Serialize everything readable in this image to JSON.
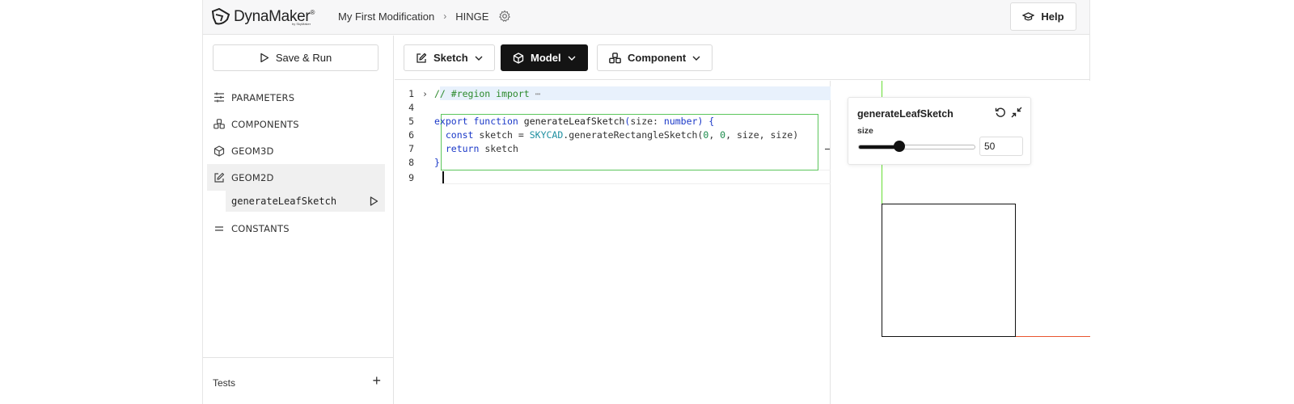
{
  "header": {
    "logo_text": "DynaMaker",
    "logo_sub": "by SkyMaker",
    "breadcrumb": [
      "My First Modification",
      "HINGE"
    ],
    "help_label": "Help"
  },
  "sidebar": {
    "save_run_label": "Save & Run",
    "items": [
      {
        "label": "PARAMETERS",
        "icon": "sliders-icon"
      },
      {
        "label": "COMPONENTS",
        "icon": "components-icon"
      },
      {
        "label": "GEOM3D",
        "icon": "cube-icon"
      },
      {
        "label": "GEOM2D",
        "icon": "edit-icon"
      },
      {
        "label": "CONSTANTS",
        "icon": "equals-icon"
      }
    ],
    "sub_item": "generateLeafSketch",
    "tests_label": "Tests"
  },
  "toolbar": {
    "sketch_label": "Sketch",
    "model_label": "Model",
    "component_label": "Component"
  },
  "editor": {
    "line_numbers": [
      "1",
      "4",
      "5",
      "6",
      "7",
      "8",
      "9"
    ]
  },
  "viewport": {
    "card_title": "generateLeafSketch",
    "param_label": "size",
    "param_value": "50",
    "slider_fraction": 0.35,
    "colors": {
      "y_axis": "#66dd33",
      "x_axis": "#e9552f"
    }
  }
}
